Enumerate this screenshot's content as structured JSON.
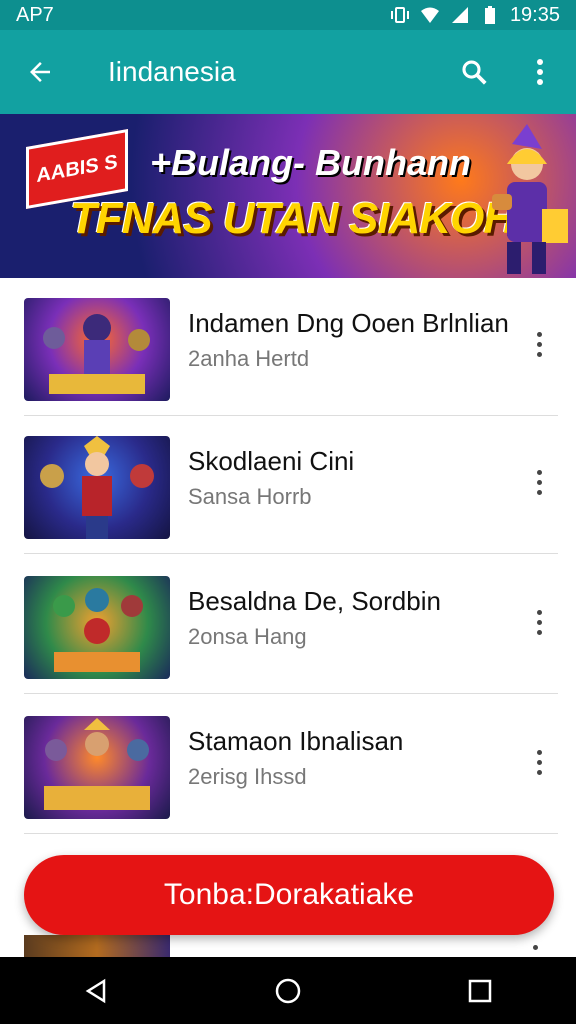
{
  "status_bar": {
    "carrier": "AP7",
    "time": "19:35"
  },
  "app_bar": {
    "title": "Iindanesia"
  },
  "banner": {
    "badge": "AABIS S",
    "line1": "+Bulang- Bunhann",
    "line2": "TFNAS UTAN SIAKOH!!"
  },
  "games": [
    {
      "title": "Indamen Dng Ooen Brlnlian",
      "subtitle": "2anha Hertd",
      "thumb_label": "DAMERBHAN"
    },
    {
      "title": "Skodlaeni Cini",
      "subtitle": "Sansa Horrb",
      "thumb_label": ""
    },
    {
      "title": "Besaldna De, Sordbin",
      "subtitle": "2onsa Hang",
      "thumb_label": "SIRLMBN"
    },
    {
      "title": "Stamaon Ibnalisan",
      "subtitle": "2erisg Ihssd",
      "thumb_label": "DSTMANIUN"
    }
  ],
  "cta": {
    "label": "Tonba:Dorakatiake"
  },
  "colors": {
    "status_bar": "#0d8f8f",
    "app_bar": "#12a1a1",
    "cta": "#e51414"
  }
}
